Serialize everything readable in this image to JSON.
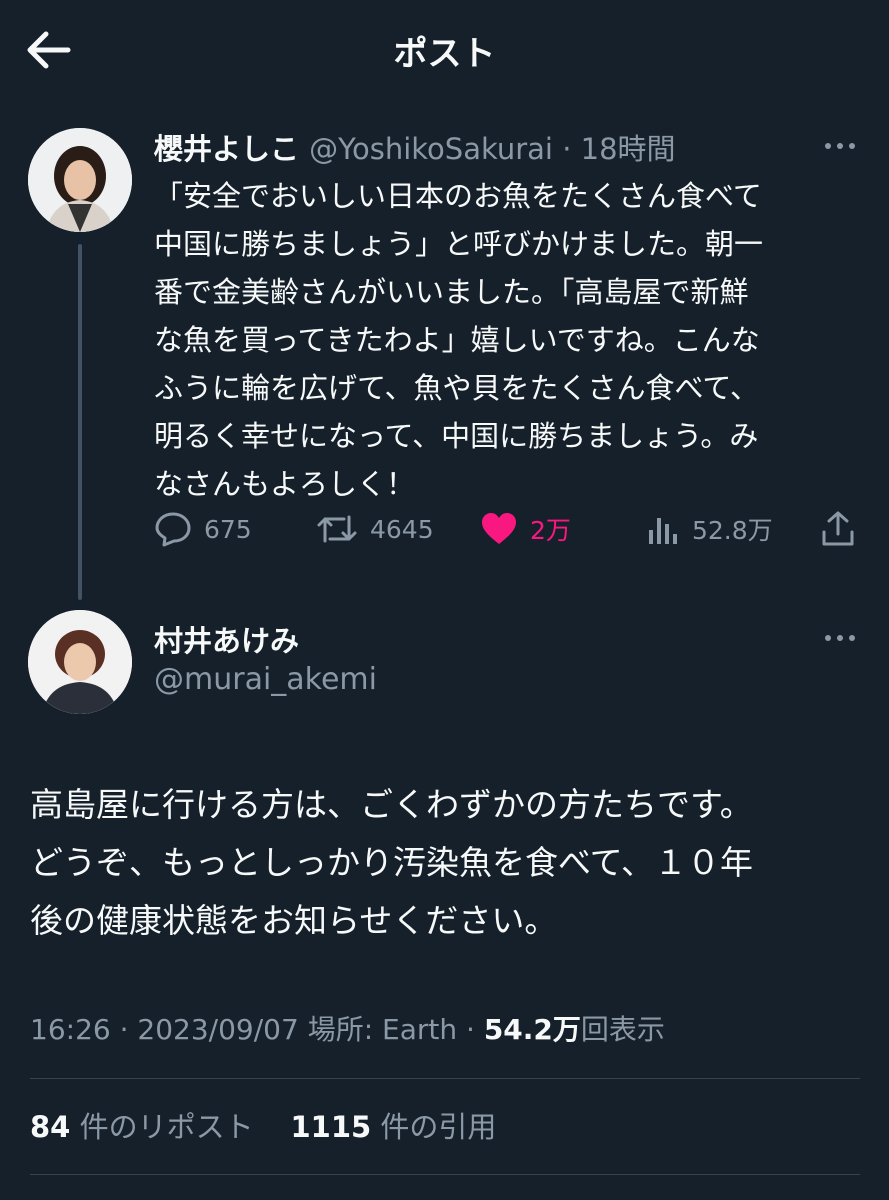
{
  "header": {
    "title": "ポスト"
  },
  "original_post": {
    "author_name": "櫻井よしこ",
    "handle": "@YoshikoSakurai",
    "separator": " · ",
    "time_ago": "18時間",
    "text_lines": [
      "「安全でおいしい日本のお魚をたくさん食べて",
      "中国に勝ちましょう」と呼びかけました。朝一",
      "番で金美齢さんがいいました。「高島屋で新鮮",
      "な魚を買ってきたわよ」嬉しいですね。こんな",
      "ふうに輪を広げて、魚や貝をたくさん食べて、",
      "明るく幸せになって、中国に勝ちましょう。み",
      "なさんもよろしく！"
    ],
    "replies": "675",
    "reposts": "4645",
    "likes": "2万",
    "views": "52.8万",
    "like_color": "#f91880"
  },
  "reply_post": {
    "author_name": "村井あけみ",
    "handle": "@murai_akemi",
    "text_lines": [
      "高島屋に行ける方は、ごくわずかの方たちです。",
      "どうぞ、もっとしっかり汚染魚を食べて、１０年",
      "後の健康状態をお知らせください。"
    ],
    "time": "16:26",
    "date": "2023/09/07",
    "location_label": "場所: Earth",
    "views_count": "54.2万",
    "views_label": "回表示"
  },
  "stats": {
    "reposts_count": "84",
    "reposts_label": "件のリポスト",
    "quotes_count": "1115",
    "quotes_label": "件の引用"
  }
}
